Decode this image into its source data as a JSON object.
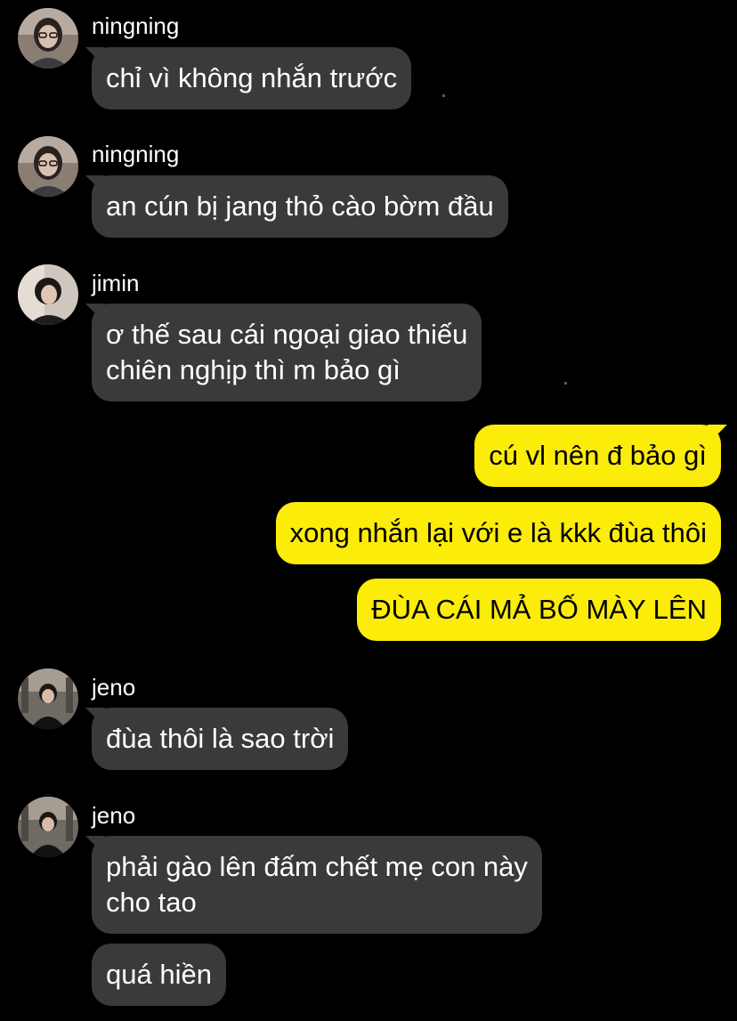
{
  "colors": {
    "background": "#000000",
    "incoming_bubble": "#3a3a3c",
    "outgoing_bubble": "#fcec0a",
    "incoming_text": "#ffffff",
    "outgoing_text": "#000000"
  },
  "messages": [
    {
      "sender": "ningning",
      "avatar_icon": "user-avatar-icon",
      "text": "chỉ vì không nhắn trước"
    },
    {
      "sender": "ningning",
      "avatar_icon": "user-avatar-icon",
      "text": "an cún bị jang thỏ cào bờm đầu"
    },
    {
      "sender": "jimin",
      "avatar_icon": "user-avatar-icon",
      "lines": [
        "ơ thế sau cái ngoại giao thiếu",
        "chiên nghịp thì m bảo gì"
      ]
    },
    {
      "outgoing": true,
      "text": "cú vl nên đ bảo gì"
    },
    {
      "outgoing": true,
      "text": "xong nhắn lại với e là kkk đùa thôi"
    },
    {
      "outgoing": true,
      "text": "ĐÙA CÁI MẢ BỐ MÀY LÊN"
    },
    {
      "sender": "jeno",
      "avatar_icon": "user-avatar-icon",
      "text": "đùa thôi là sao trời"
    },
    {
      "sender": "jeno",
      "avatar_icon": "user-avatar-icon",
      "lines": [
        "phải gào lên đấm chết mẹ con này",
        "cho tao"
      ]
    },
    {
      "sender": "jeno",
      "text": "quá hiền"
    }
  ]
}
